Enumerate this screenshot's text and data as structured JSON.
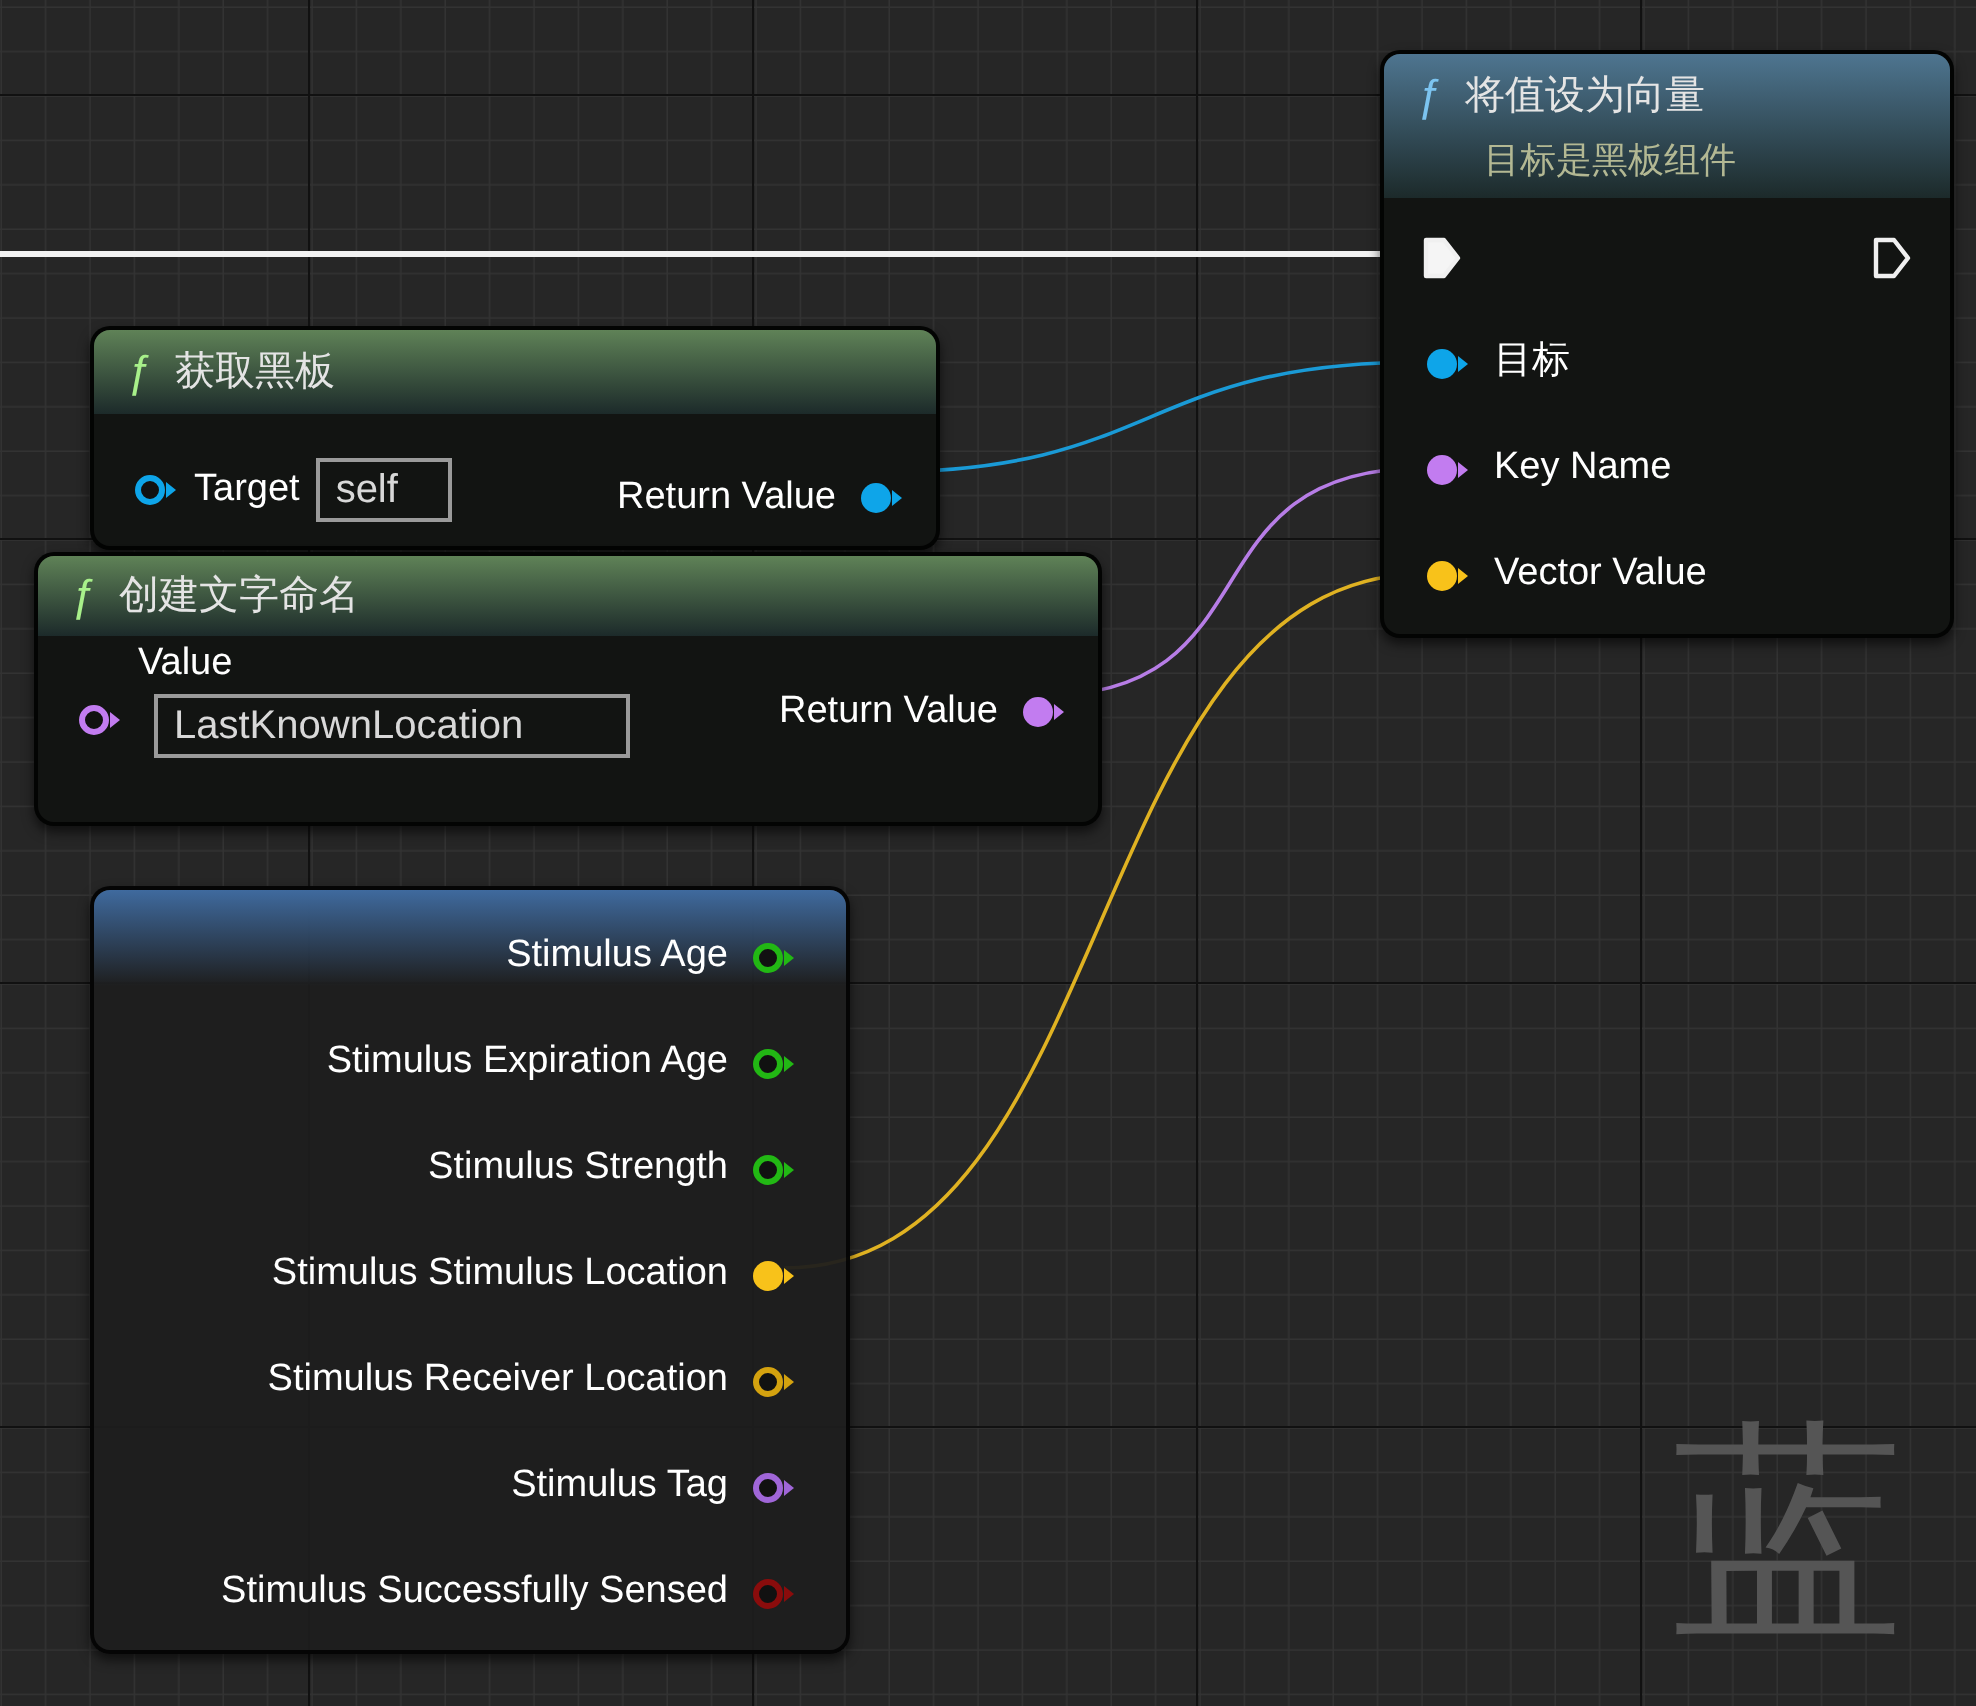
{
  "nodes": [
    {
      "icon": "ƒ",
      "title": "将值设为向量",
      "subtitle": "目标是黑板组件",
      "color": "#4e7590",
      "exec_in": {
        "connected": true
      },
      "exec_out": {
        "connected": false
      },
      "inputs": [
        {
          "label": "目标",
          "color": "#0ea5e9",
          "connected": true
        },
        {
          "label": "Key Name",
          "color": "#c27cf0",
          "connected": true
        },
        {
          "label": "Vector Value",
          "color": "#f8c21a",
          "connected": true
        }
      ]
    },
    {
      "icon": "ƒ",
      "title": "获取黑板",
      "color": "#5f8257",
      "inputs": [
        {
          "label": "Target",
          "color": "#0ea5e9",
          "connected": false,
          "value": "self"
        }
      ],
      "outputs": [
        {
          "label": "Return Value",
          "color": "#0ea5e9",
          "connected": true
        }
      ]
    },
    {
      "icon": "ƒ",
      "title": "创建文字命名",
      "color": "#5f8257",
      "inputs": [
        {
          "label": "Value",
          "color": "#c27cf0",
          "connected": false,
          "value": "LastKnownLocation"
        }
      ],
      "outputs": [
        {
          "label": "Return Value",
          "color": "#c27cf0",
          "connected": true
        }
      ]
    },
    {
      "color": "#3f6a9e",
      "outputs": [
        {
          "label": "Stimulus Age",
          "color": "#22b814",
          "connected": false
        },
        {
          "label": "Stimulus Expiration Age",
          "color": "#22b814",
          "connected": false
        },
        {
          "label": "Stimulus Strength",
          "color": "#22b814",
          "connected": false
        },
        {
          "label": "Stimulus Stimulus Location",
          "color": "#f8c21a",
          "connected": true
        },
        {
          "label": "Stimulus Receiver Location",
          "color": "#d4a20f",
          "connected": false
        },
        {
          "label": "Stimulus Tag",
          "color": "#a066d8",
          "connected": false
        },
        {
          "label": "Stimulus Successfully Sensed",
          "color": "#8a0c0c",
          "connected": false
        }
      ]
    }
  ],
  "graph_label": "蓝"
}
